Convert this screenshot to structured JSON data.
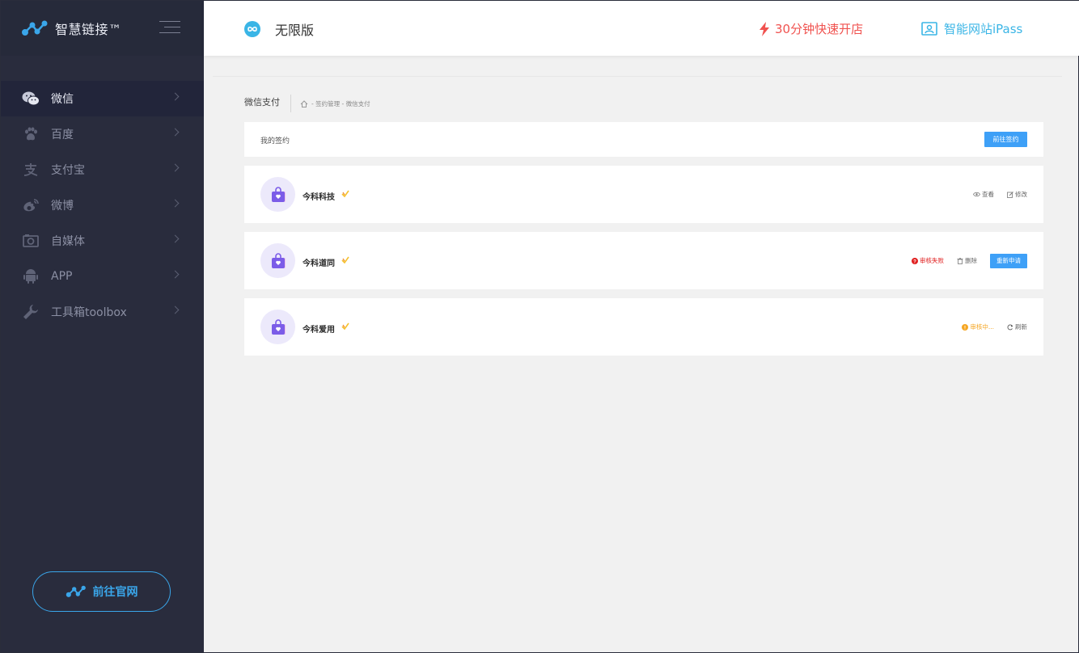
{
  "sidebar": {
    "brand_name": "智慧链接™",
    "items": [
      {
        "label": "微信",
        "icon": "wechat-icon",
        "active": true
      },
      {
        "label": "百度",
        "icon": "paw-icon",
        "active": false
      },
      {
        "label": "支付宝",
        "icon": "alipay-icon",
        "active": false
      },
      {
        "label": "微博",
        "icon": "weibo-icon",
        "active": false
      },
      {
        "label": "自媒体",
        "icon": "camera-icon",
        "active": false
      },
      {
        "label": "APP",
        "icon": "android-icon",
        "active": false
      },
      {
        "label": "工具箱toolbox",
        "icon": "wrench-icon",
        "active": false
      }
    ],
    "site_button": "前往官网"
  },
  "header": {
    "edition": "无限版",
    "quick_open": "30分钟快速开店",
    "ipass": "智能网站iPass"
  },
  "breadcrumb": {
    "title": "微信支付",
    "path": "- 签约管理 - 微信支付"
  },
  "contracts": {
    "title": "我的签约",
    "go_button": "前往签约",
    "items": [
      {
        "name": "今科科技",
        "actions": {
          "view": "查看",
          "edit": "修改"
        }
      },
      {
        "name": "今科道同",
        "actions": {
          "status": "审核失败",
          "delete": "删除",
          "reapply": "重新申请"
        }
      },
      {
        "name": "今科爱用",
        "actions": {
          "status": "审核中...",
          "refresh": "刷新"
        }
      }
    ]
  },
  "colors": {
    "sidebar_bg": "#292c3d",
    "accent_blue": "#3ea0f7",
    "quick_open_red": "#f0524f",
    "ipass_cyan": "#3ab5e6",
    "fail_red": "#e02020",
    "pending_orange": "#f5a623"
  }
}
